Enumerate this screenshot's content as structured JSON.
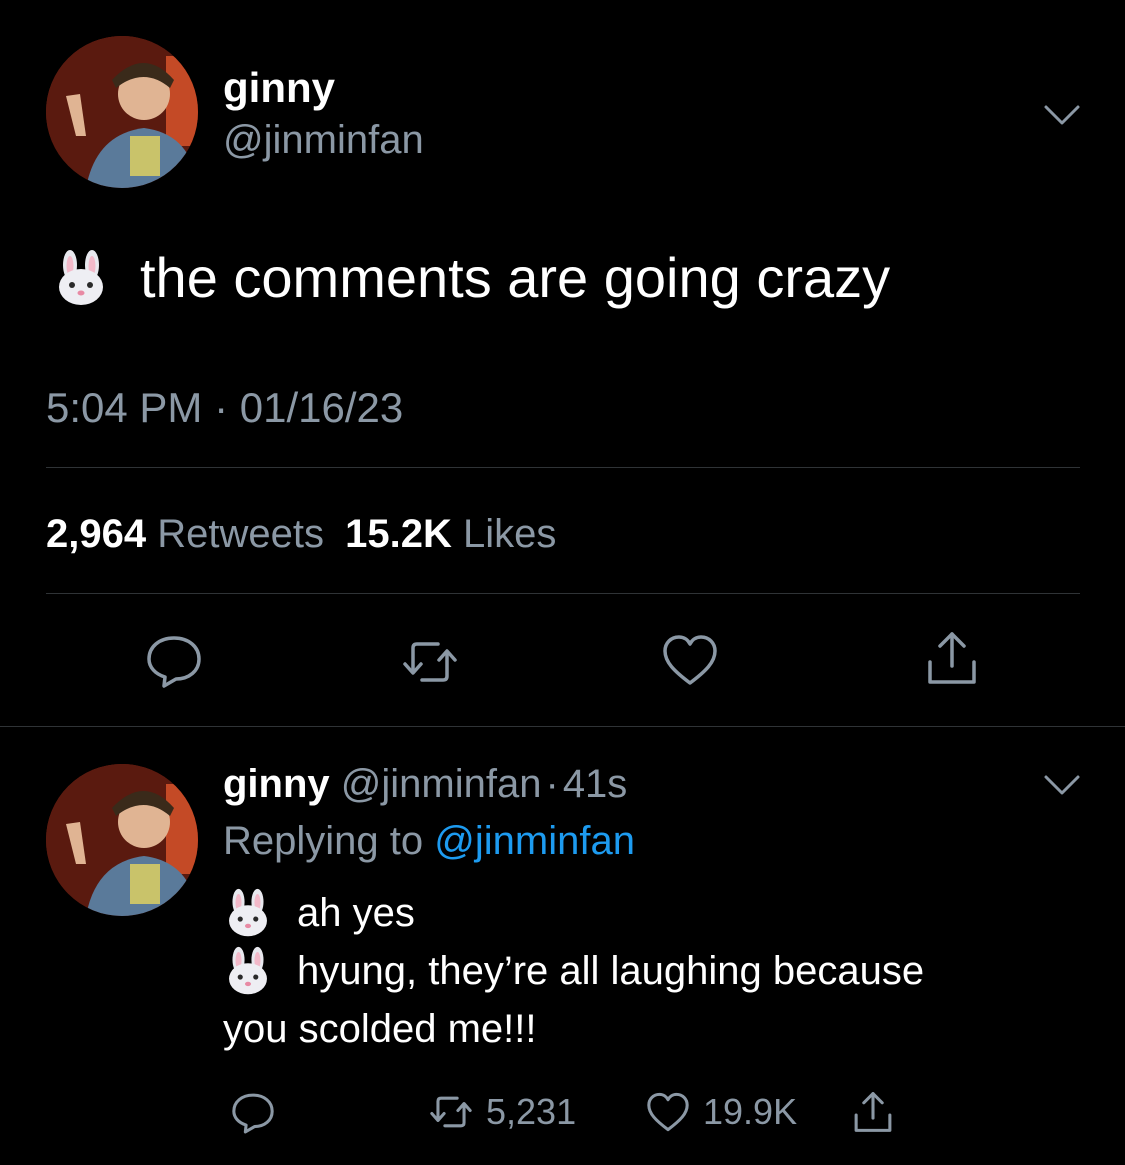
{
  "main_tweet": {
    "name": "ginny",
    "handle": "@jinminfan",
    "text": "the comments are going crazy",
    "emoji": "rabbit-face",
    "timestamp": "5:04 PM · 01/16/23",
    "retweets_count": "2,964",
    "retweets_label": "Retweets",
    "likes_count": "15.2K",
    "likes_label": "Likes"
  },
  "reply": {
    "name": "ginny",
    "handle": "@jinminfan",
    "separator": "·",
    "age": "41s",
    "replying_label": "Replying to",
    "replying_to": "@jinminfan",
    "line1": "ah yes",
    "line2": "hyung, they’re all laughing because",
    "line3": "you scolded me!!!",
    "retweets_count": "5,231",
    "likes_count": "19.9K"
  },
  "colors": {
    "background": "#000000",
    "text_primary": "#ffffff",
    "text_secondary": "#8b98a5",
    "link": "#1d9bf0",
    "divider": "#2f3336"
  },
  "icons": {
    "reply": "reply-bubble-icon",
    "retweet": "retweet-icon",
    "like": "heart-icon",
    "share": "share-icon",
    "more": "chevron-down-icon"
  }
}
